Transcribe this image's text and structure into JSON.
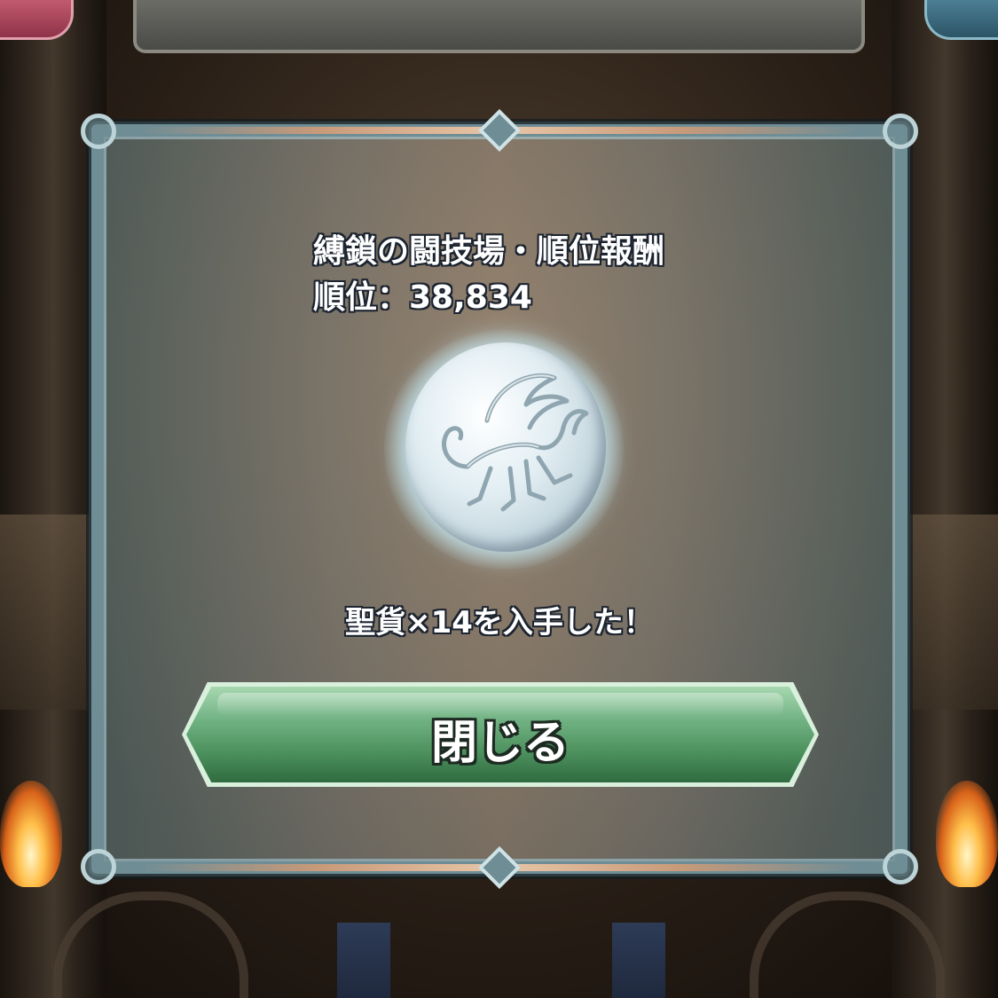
{
  "reward_dialog": {
    "title": "縛鎖の闘技場・順位報酬",
    "rank_text": "順位：38,834",
    "item_name": "聖貨",
    "item_icon": "pegasus-coin-icon",
    "obtained_message": "聖貨×14を入手した！",
    "close_label": "閉じる"
  },
  "colors": {
    "frame": "#6f8d95",
    "frame_accent": "#e8c6a8",
    "button_green": "#4b8f5c",
    "text_outline": "#1c2430"
  }
}
